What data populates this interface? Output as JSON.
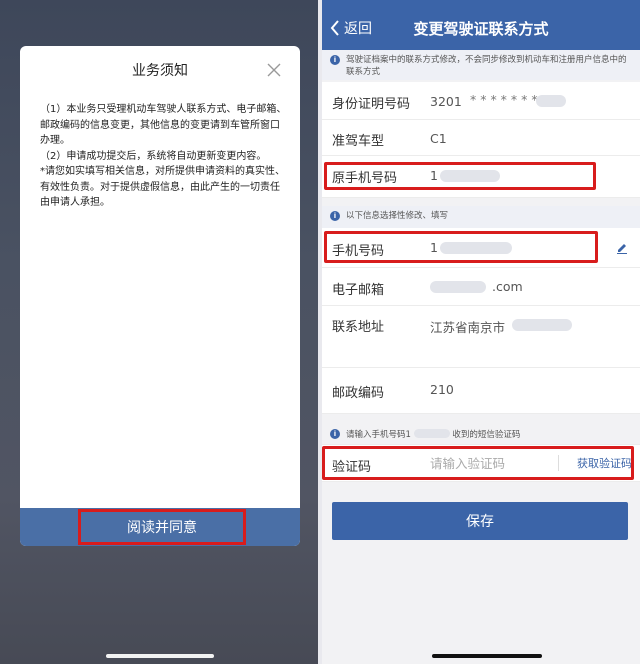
{
  "modal": {
    "title": "业务须知",
    "para1": "（1）本业务只受理机动车驾驶人联系方式、电子邮箱、邮政编码的信息变更，其他信息的变更请到车管所窗口办理。",
    "para2": "（2）申请成功提交后，系统将自动更新变更内容。",
    "para3": "*请您如实填写相关信息，对所提供申请资料的真实性、有效性负责。对于提供虚假信息，由此产生的一切责任由申请人承担。",
    "agree_label": "阅读并同意"
  },
  "header": {
    "back_label": "返回",
    "title": "变更驾驶证联系方式"
  },
  "notice_top": "驾驶证档案中的联系方式修改，不会同步修改到机动车和注册用户信息中的联系方式",
  "fields": {
    "id_label": "身份证明号码",
    "id_value": "3201",
    "id_mask": "* * * * * * *",
    "class_label": "准驾车型",
    "class_value": "C1",
    "orig_phone_label": "原手机号码",
    "orig_phone_value": "1",
    "phone_label": "手机号码",
    "phone_value": "1",
    "email_label": "电子邮箱",
    "email_value": ".com",
    "address_label": "联系地址",
    "address_value": "江苏省南京市",
    "zip_label": "邮政编码",
    "zip_value": "210"
  },
  "notice_mid": "以下信息选择性修改、填写",
  "notice_sms_a": "请输入手机号码1",
  "notice_sms_b": "收到的短信验证码",
  "verify": {
    "label": "验证码",
    "placeholder": "请输入验证码",
    "get_code_label": "获取验证码"
  },
  "save_label": "保存",
  "colors": {
    "brand_blue": "#3b64a8",
    "highlight_red": "#d81c1c"
  },
  "icons": [
    "close-icon",
    "back-chevron-icon",
    "info-icon",
    "edit-pencil-icon"
  ]
}
